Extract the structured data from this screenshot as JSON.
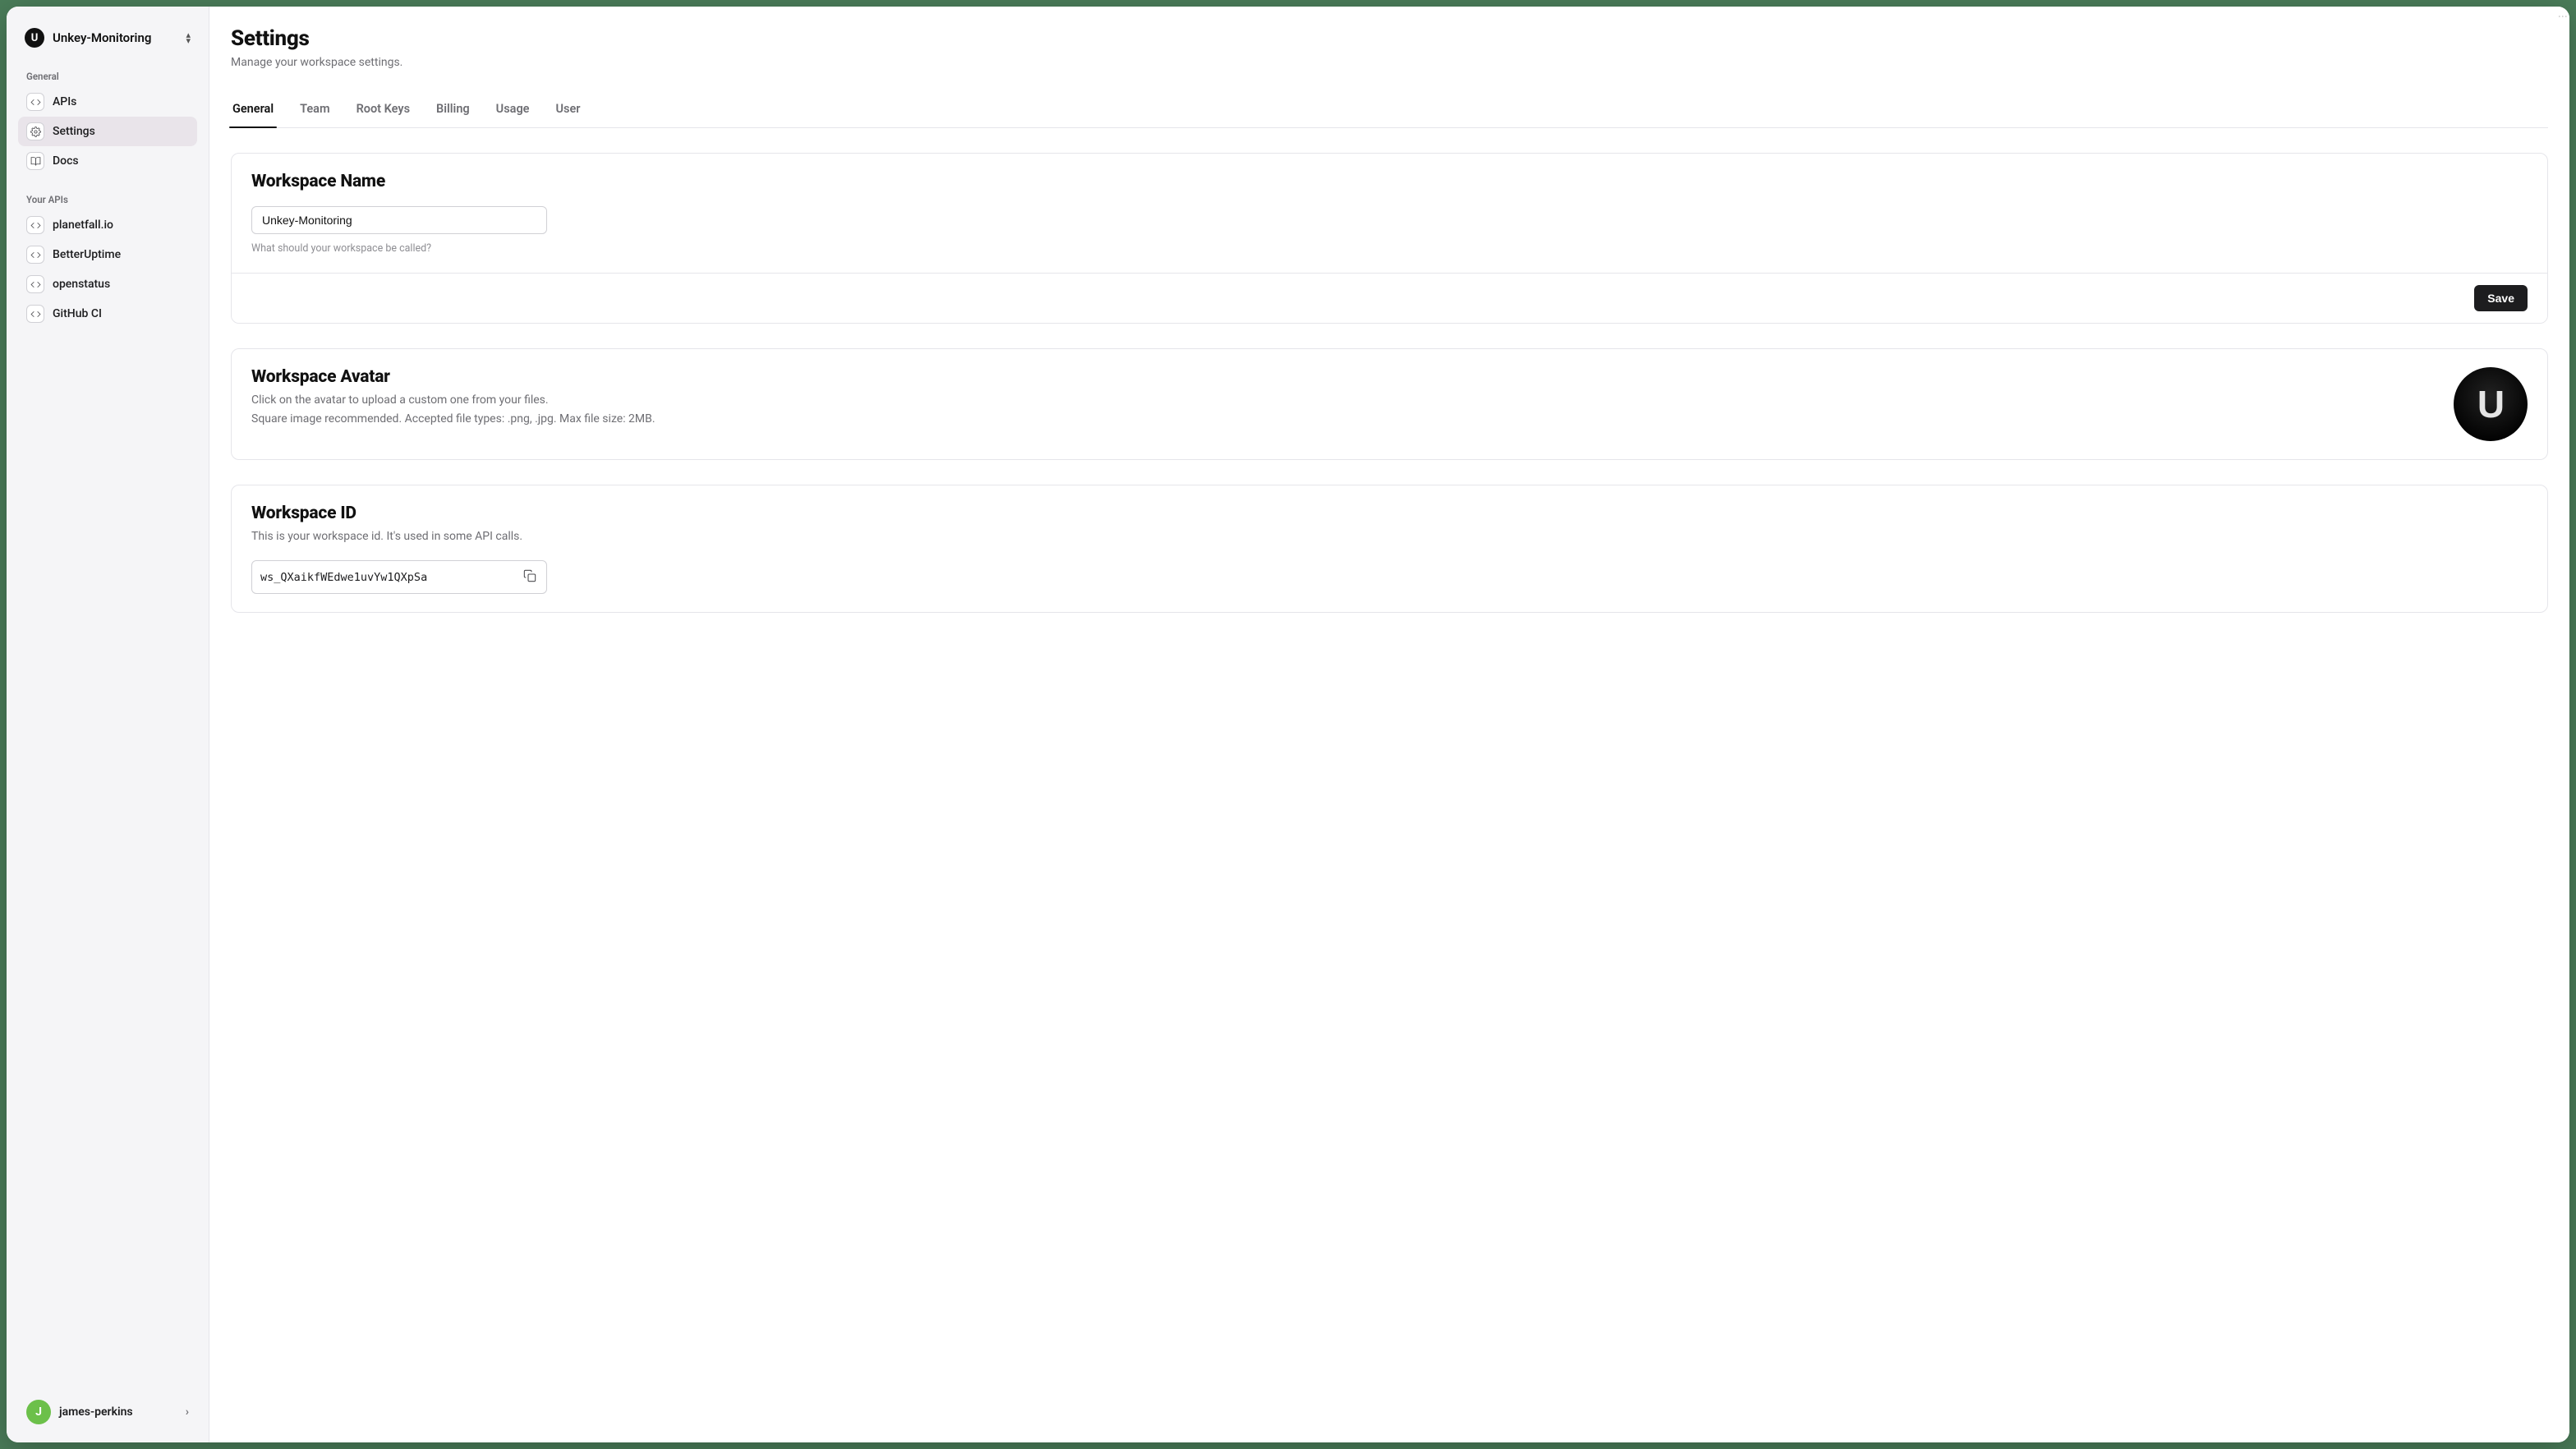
{
  "workspace": {
    "logo_letter": "U",
    "name": "Unkey-Monitoring"
  },
  "sidebar": {
    "general_label": "General",
    "items": [
      {
        "label": "APIs",
        "icon": "code-icon",
        "active": false
      },
      {
        "label": "Settings",
        "icon": "gear-icon",
        "active": true
      },
      {
        "label": "Docs",
        "icon": "book-icon",
        "active": false
      }
    ],
    "your_apis_label": "Your APIs",
    "apis": [
      {
        "label": "planetfall.io"
      },
      {
        "label": "BetterUptime"
      },
      {
        "label": "openstatus"
      },
      {
        "label": "GitHub CI"
      }
    ]
  },
  "user": {
    "avatar_letter": "J",
    "name": "james-perkins"
  },
  "page": {
    "title": "Settings",
    "subtitle": "Manage your workspace settings."
  },
  "tabs": [
    {
      "label": "General",
      "active": true
    },
    {
      "label": "Team",
      "active": false
    },
    {
      "label": "Root Keys",
      "active": false
    },
    {
      "label": "Billing",
      "active": false
    },
    {
      "label": "Usage",
      "active": false
    },
    {
      "label": "User",
      "active": false
    }
  ],
  "cards": {
    "name": {
      "title": "Workspace Name",
      "value": "Unkey-Monitoring",
      "help": "What should your workspace be called?",
      "save_label": "Save"
    },
    "avatar": {
      "title": "Workspace Avatar",
      "desc_line1": "Click on the avatar to upload a custom one from your files.",
      "desc_line2": "Square image recommended. Accepted file types: .png, .jpg. Max file size: 2MB.",
      "letter": "U"
    },
    "id": {
      "title": "Workspace ID",
      "desc": "This is your workspace id. It's used in some API calls.",
      "value": "ws_QXaikfWEdwe1uvYw1QXpSa"
    }
  }
}
